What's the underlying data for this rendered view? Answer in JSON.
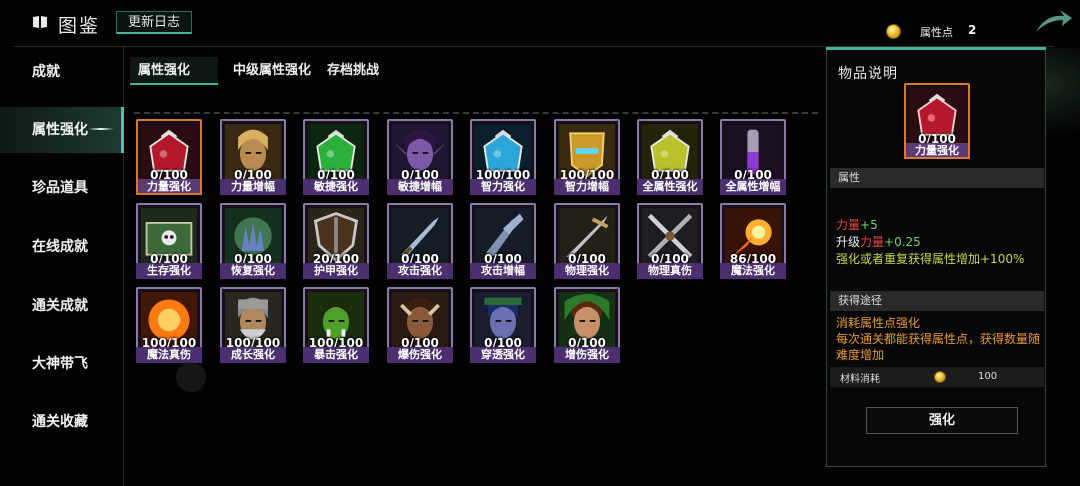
{
  "header": {
    "title": "图鉴",
    "changelog_label": "更新日志",
    "attr_points_label": "属性点",
    "attr_points_value": "2"
  },
  "sidebar": {
    "items": [
      {
        "label": "成就"
      },
      {
        "label": "属性强化"
      },
      {
        "label": "珍品道具"
      },
      {
        "label": "在线成就"
      },
      {
        "label": "通关成就"
      },
      {
        "label": "大神带飞"
      },
      {
        "label": "通关收藏"
      }
    ]
  },
  "tabs": [
    {
      "label": "属性强化"
    },
    {
      "label": "中级属性强化"
    },
    {
      "label": "存档挑战"
    }
  ],
  "items": [
    {
      "name": "力量强化",
      "count": "0/100",
      "art": "red-potion"
    },
    {
      "name": "力量增幅",
      "count": "0/100",
      "art": "orc-warrior"
    },
    {
      "name": "敏捷强化",
      "count": "0/100",
      "art": "green-potion"
    },
    {
      "name": "敏捷增幅",
      "count": "0/100",
      "art": "night-elf"
    },
    {
      "name": "智力强化",
      "count": "100/100",
      "art": "blue-potion"
    },
    {
      "name": "智力增幅",
      "count": "100/100",
      "art": "golden-mask"
    },
    {
      "name": "全属性强化",
      "count": "0/100",
      "art": "yellow-potion"
    },
    {
      "name": "全属性增幅",
      "count": "0/100",
      "art": "vial"
    },
    {
      "name": "生存强化",
      "count": "0/100",
      "art": "tome"
    },
    {
      "name": "恢复强化",
      "count": "0/100",
      "art": "hand-glow"
    },
    {
      "name": "护甲强化",
      "count": "20/100",
      "art": "shield"
    },
    {
      "name": "攻击强化",
      "count": "0/100",
      "art": "dagger"
    },
    {
      "name": "攻击增幅",
      "count": "0/100",
      "art": "claw"
    },
    {
      "name": "物理强化",
      "count": "0/100",
      "art": "sword"
    },
    {
      "name": "物理真伤",
      "count": "0/100",
      "art": "crossed-blades"
    },
    {
      "name": "魔法强化",
      "count": "86/100",
      "art": "fireball"
    },
    {
      "name": "魔法真伤",
      "count": "100/100",
      "art": "fire-burst"
    },
    {
      "name": "成长强化",
      "count": "100/100",
      "art": "dwarf"
    },
    {
      "name": "暴击强化",
      "count": "100/100",
      "art": "orc-face"
    },
    {
      "name": "爆伤强化",
      "count": "0/100",
      "art": "beast"
    },
    {
      "name": "穿透强化",
      "count": "0/100",
      "art": "elf-archer"
    },
    {
      "name": "增伤强化",
      "count": "0/100",
      "art": "hooded"
    }
  ],
  "panel": {
    "title": "物品说明",
    "selected_name": "力量强化",
    "selected_count": "0/100",
    "section_attr": "属性",
    "attr_line1_name": "力量",
    "attr_line1_val": "+5",
    "attr_line2_prefix": "升级",
    "attr_line2_name": "力量",
    "attr_line2_val": "+0.25",
    "attr_line3": "强化或者重复获得属性增加+100%",
    "section_source": "获得途径",
    "source_line1": "消耗属性点强化",
    "source_line2": "每次通关都能获得属性点，获得数量随难度增加",
    "material_label": "材料消耗",
    "material_value": "100",
    "button_label": "强化"
  }
}
